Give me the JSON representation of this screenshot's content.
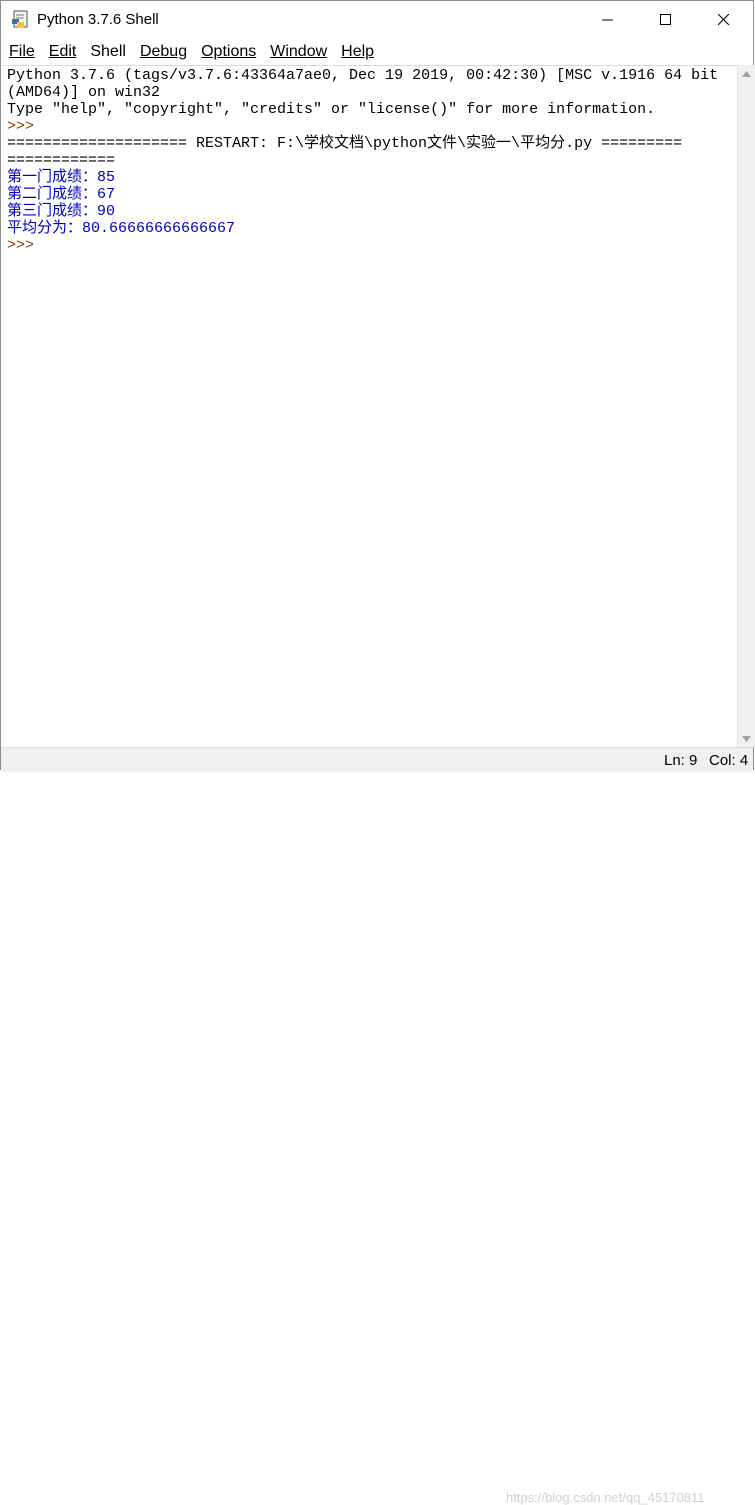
{
  "window": {
    "title": "Python 3.7.6 Shell",
    "icon": "python-idle-icon"
  },
  "menu": [
    "File",
    "Edit",
    "Shell",
    "Debug",
    "Options",
    "Window",
    "Help"
  ],
  "shell": {
    "lines": [
      {
        "text": "Python 3.7.6 (tags/v3.7.6:43364a7ae0, Dec 19 2019, 00:42:30) [MSC v.1916 64 bit",
        "kind": "plain"
      },
      {
        "text": "(AMD64)] on win32",
        "kind": "plain"
      },
      {
        "text": "Type \"help\", \"copyright\", \"credits\" or \"license()\" for more information.",
        "kind": "plain"
      },
      {
        "text": ">>>",
        "kind": "prompt"
      },
      {
        "text": "==================== RESTART: F:\\学校文档\\python文件\\实验一\\平均分.py =========",
        "kind": "plain"
      },
      {
        "text": "============",
        "kind": "plain"
      },
      {
        "text": "第一门成绩：85",
        "kind": "out"
      },
      {
        "text": "第二门成绩：67",
        "kind": "out"
      },
      {
        "text": "第三门成绩：90",
        "kind": "out"
      },
      {
        "text": "平均分为：80.66666666666667",
        "kind": "out"
      },
      {
        "text": ">>>",
        "kind": "prompt"
      }
    ]
  },
  "status": {
    "ln": "Ln: 9",
    "col": "Col: 4"
  },
  "watermark": "https://blog.csdn.net/qq_45170811",
  "colors": {
    "output": "#0000c0",
    "prompt": "#7f3f00"
  }
}
